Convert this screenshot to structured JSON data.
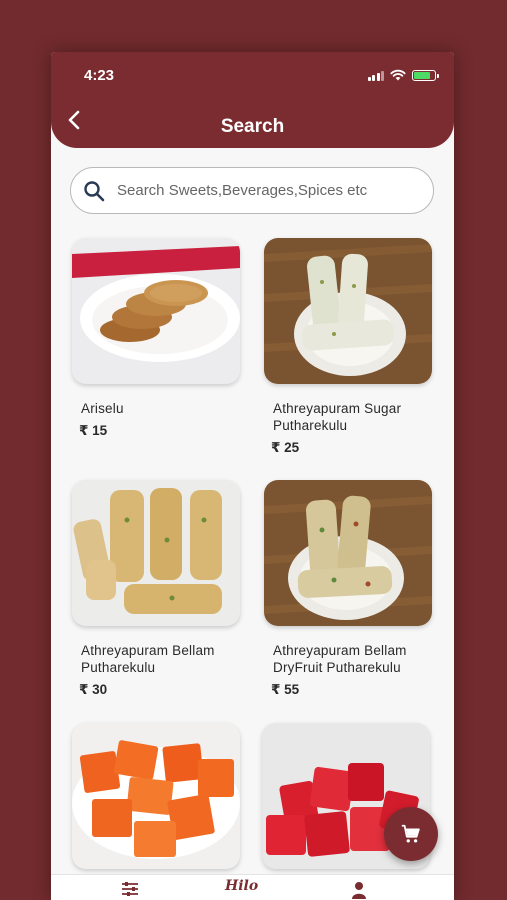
{
  "status_bar": {
    "time": "4:23"
  },
  "header": {
    "title": "Search"
  },
  "search": {
    "placeholder": "Search Sweets,Beverages,Spices etc"
  },
  "products": [
    {
      "name": "Ariselu",
      "price": "₹ 15"
    },
    {
      "name": "Athreyapuram Sugar Putharekulu",
      "price": "₹ 25"
    },
    {
      "name": "Athreyapuram Bellam Putharekulu",
      "price": "₹ 30"
    },
    {
      "name": "Athreyapuram Bellam DryFruit Putharekulu",
      "price": "₹ 55"
    },
    {
      "name": "",
      "price": ""
    },
    {
      "name": "",
      "price": ""
    }
  ],
  "bottom_nav": {
    "logo_text": "Hilo"
  },
  "colors": {
    "brand": "#7a2c31",
    "background": "#722b2e",
    "surface": "#f7f7f7"
  },
  "icons": [
    "back-icon",
    "search-icon",
    "cart-icon",
    "filter-icon",
    "profile-icon"
  ]
}
